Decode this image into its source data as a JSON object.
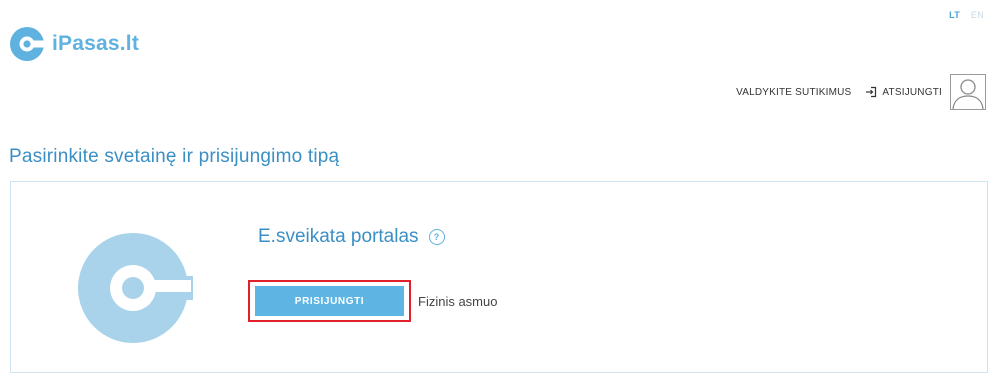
{
  "languages": [
    "LT",
    "EN"
  ],
  "brand": {
    "name": "iPasas.lt"
  },
  "nav": {
    "consents_label": "VALDYKITE SUTIKIMUS",
    "logout_label": "ATSIJUNGTI"
  },
  "main": {
    "title": "Pasirinkite svetainę ir prisijungimo tipą",
    "site": {
      "name": "E.sveikata portalas",
      "help_symbol": "?",
      "login_button": "PRISIJUNGTI",
      "login_type": "Fizinis asmuo"
    }
  },
  "icons": {
    "brand_logo": "key-logo-icon",
    "logout": "logout-arrow-icon",
    "avatar": "user-avatar-icon",
    "help": "help-circle-icon"
  },
  "colors": {
    "brand": "#5fb2df",
    "title": "#3a8fc4",
    "button": "#5eb5e4",
    "highlight": "#e0202a",
    "logo_light": "#a8d3ea"
  }
}
